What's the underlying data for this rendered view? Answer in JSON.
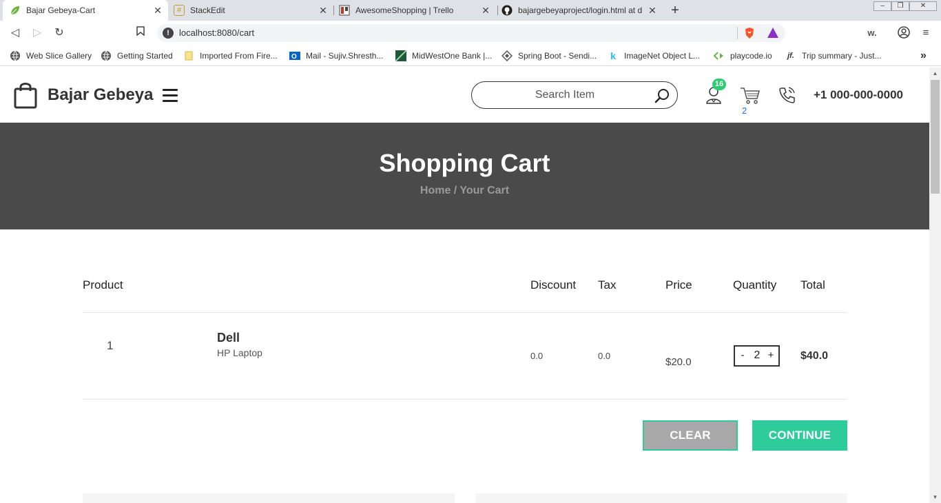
{
  "browser": {
    "tabs": [
      {
        "title": "Bajar Gebeya-Cart",
        "icon": "leaf-icon",
        "active": true
      },
      {
        "title": "StackEdit",
        "icon": "stackedit-icon",
        "active": false
      },
      {
        "title": "AwesomeShopping | Trello",
        "icon": "trello-icon",
        "active": false
      },
      {
        "title": "bajargebeyaproject/login.html at d",
        "icon": "github-icon",
        "active": false
      }
    ],
    "new_tab": "+",
    "window_controls": [
      "–",
      "❐",
      "✕"
    ],
    "url": "localhost:8080/cart",
    "bookmarks": [
      "Web Slice Gallery",
      "Getting Started",
      "Imported From Fire...",
      "Mail - Sujiv.Shresth...",
      "MidWestOne Bank |...",
      "Spring Boot - Sendi...",
      "ImageNet Object L...",
      "playcode.io",
      "Trip summary - Just..."
    ],
    "bookmarks_more": "»",
    "ext_label": "w."
  },
  "header": {
    "brand": "Bajar Gebeya",
    "search_placeholder": "Search Item",
    "user_badge": "16",
    "cart_count": "2",
    "phone": "+1 000-000-0000"
  },
  "banner": {
    "title": "Shopping Cart",
    "crumb_home": "Home",
    "crumb_sep": " / ",
    "crumb_current": "Your Cart"
  },
  "cart": {
    "headers": {
      "product": "Product",
      "discount": "Discount",
      "tax": "Tax",
      "price": "Price",
      "quantity": "Quantity",
      "total": "Total"
    },
    "items": [
      {
        "index": "1",
        "name": "Dell",
        "description": "HP Laptop",
        "discount": "0.0",
        "tax": "0.0",
        "price": "$20.0",
        "quantity": "2",
        "total": "$40.0"
      }
    ],
    "qty_minus": "-",
    "qty_plus": "+",
    "clear_label": "CLEAR",
    "continue_label": "CONTINUE"
  },
  "colors": {
    "accent": "#2ecc9a",
    "banner_bg": "#4a4a4a",
    "badge": "#2ecc71"
  }
}
